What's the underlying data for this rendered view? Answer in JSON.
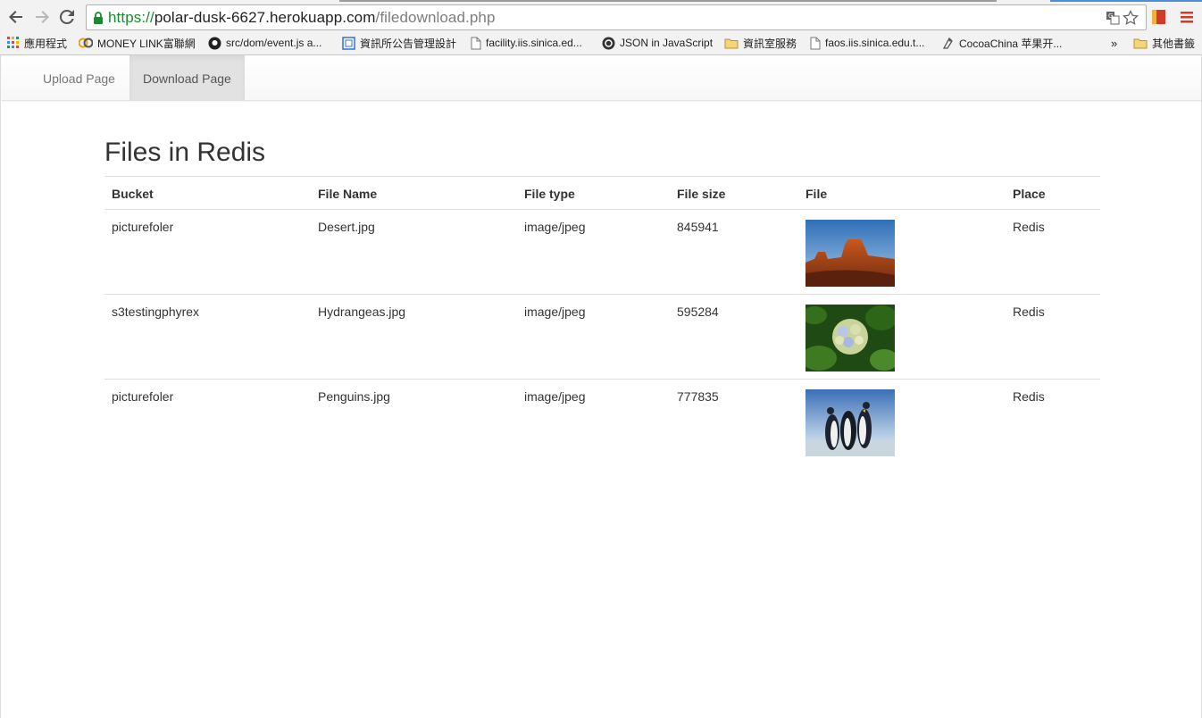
{
  "browser": {
    "url_scheme": "https://",
    "url_host": "polar-dusk-6627.herokuapp.com",
    "url_path": "/filedownload.php",
    "bookmarks": [
      {
        "label": "應用程式",
        "icon": "apps-grid-icon"
      },
      {
        "label": "MONEY LINK富聯網",
        "icon": "moneylink-icon"
      },
      {
        "label": "src/dom/event.js a...",
        "icon": "github-icon"
      },
      {
        "label": "資訊所公告管理設計",
        "icon": "page-blue-icon"
      },
      {
        "label": "facility.iis.sinica.ed...",
        "icon": "page-icon"
      },
      {
        "label": "JSON in JavaScript",
        "icon": "json-icon"
      },
      {
        "label": "資訊室服務",
        "icon": "folder-icon"
      },
      {
        "label": "faos.iis.sinica.edu.t...",
        "icon": "page-icon"
      },
      {
        "label": "CocoaChina 苹果开...",
        "icon": "cocoachina-icon"
      }
    ],
    "overflow_label": "»",
    "other_bookmarks": "其他書籤"
  },
  "nav": {
    "items": [
      {
        "label": "Upload Page",
        "active": false
      },
      {
        "label": "Download Page",
        "active": true
      }
    ]
  },
  "main": {
    "title": "Files in Redis",
    "columns": [
      "Bucket",
      "File Name",
      "File type",
      "File size",
      "File",
      "Place"
    ],
    "rows": [
      {
        "bucket": "picturefoler",
        "file_name": "Desert.jpg",
        "file_type": "image/jpeg",
        "file_size": "845941",
        "thumb": "desert-thumbnail",
        "place": "Redis"
      },
      {
        "bucket": "s3testingphyrex",
        "file_name": "Hydrangeas.jpg",
        "file_type": "image/jpeg",
        "file_size": "595284",
        "thumb": "hydrangeas-thumbnail",
        "place": "Redis"
      },
      {
        "bucket": "picturefoler",
        "file_name": "Penguins.jpg",
        "file_type": "image/jpeg",
        "file_size": "777835",
        "thumb": "penguins-thumbnail",
        "place": "Redis"
      }
    ]
  },
  "colors": {
    "secure_green": "#1a8a2e",
    "nav_active_bg": "#e2e2e2",
    "text": "#333333"
  }
}
